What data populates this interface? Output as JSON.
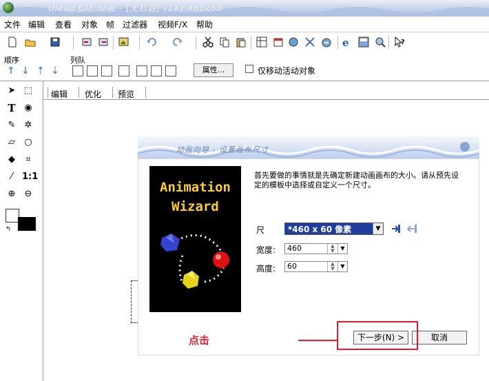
{
  "window": {
    "title": "Ulead GIF 动画 - [无标题] (1X) 460x60"
  },
  "menu": [
    "文件",
    "编辑",
    "查看",
    "对象",
    "帧",
    "过滤器",
    "视频F/X",
    "帮助"
  ],
  "toolbar2": {
    "order_label": "顺序",
    "queue_label": "列队",
    "properties_button": "属性...",
    "move_active_only": "仅移动活动对象"
  },
  "tabs": [
    "编辑",
    "优化",
    "预览"
  ],
  "dialog": {
    "title": "动画向导 - 设置画布尺寸",
    "wizard_line1": "Animation",
    "wizard_line2": "Wizard",
    "intro": "首先要做的事情就是先确定新建动画画布的大小。请从预先设定的模板中选择或自定义一个尺寸。",
    "size_label": "尺",
    "size_value": "*460 x 60 像素",
    "width_label": "宽度:",
    "width_value": "460",
    "height_label": "高度:",
    "height_value": "60",
    "next_button": "下一步(N) >",
    "cancel_button": "取消"
  },
  "annotation": {
    "click_label": "点击",
    "color": "#e01b2c"
  }
}
